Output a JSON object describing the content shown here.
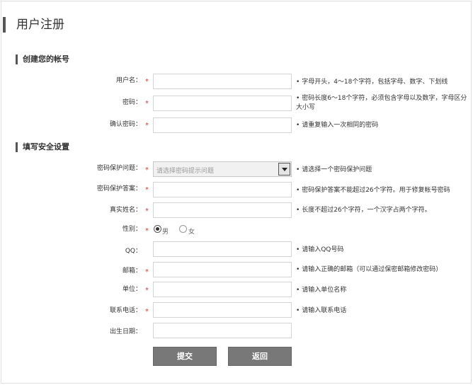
{
  "page": {
    "title": "用户注册"
  },
  "sections": {
    "account": {
      "title": "创建您的帐号"
    },
    "security": {
      "title": "填写安全设置"
    }
  },
  "fields": {
    "username": {
      "label": "用户名：",
      "required": true,
      "value": "",
      "hint": "字母开头，4～18个字符，包括字母、数字、下划线"
    },
    "password": {
      "label": "密码：",
      "required": true,
      "value": "",
      "hint": "密码长度6～18个字符，必须包含字母以及数字，字母区分大小写"
    },
    "confirm_password": {
      "label": "确认密码：",
      "required": true,
      "value": "",
      "hint": "请重复输入一次相同的密码"
    },
    "security_question": {
      "label": "密码保护问题：",
      "required": true,
      "selected": "请选择密码提示问题",
      "hint": "请选择一个密码保护问题"
    },
    "security_answer": {
      "label": "密码保护答案：",
      "required": true,
      "value": "",
      "hint": "密码保护答案不能超过26个字符。用于修复帐号密码"
    },
    "real_name": {
      "label": "真实姓名：",
      "required": true,
      "value": "",
      "hint": "长度不超过26个字符，一个汉字占两个字符。"
    },
    "gender": {
      "label": "性别：",
      "required": true,
      "options": [
        "男",
        "女"
      ],
      "selected": "男"
    },
    "qq": {
      "label": "QQ：",
      "required": false,
      "value": "",
      "hint": "请输入QQ号码"
    },
    "email": {
      "label": "邮箱：",
      "required": true,
      "value": "",
      "hint": "请输入正确的邮箱（可以通过保密邮箱修改密码）"
    },
    "company": {
      "label": "单位：",
      "required": true,
      "value": "",
      "hint": "请输入单位名称"
    },
    "phone": {
      "label": "联系电话：",
      "required": true,
      "value": "",
      "hint": "请输入联系电话"
    },
    "birthday": {
      "label": "出生日期：",
      "required": false,
      "value": ""
    }
  },
  "required_mark": "*",
  "hint_bullet": "•",
  "buttons": {
    "submit": "提交",
    "back": "返回"
  },
  "colors": {
    "required": "#dd3333",
    "button": "#787878",
    "accent_bar": "#555555"
  },
  "icons": {
    "dropdown": "chevron-down-icon"
  }
}
